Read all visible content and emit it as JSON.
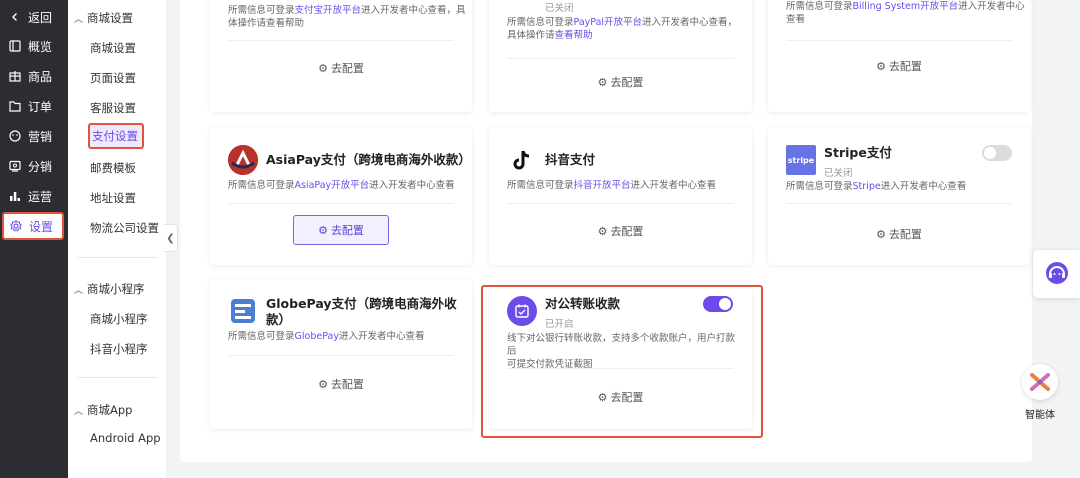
{
  "leftnav": {
    "back": "返回",
    "items": [
      {
        "label": "概览",
        "icon": "overview-icon"
      },
      {
        "label": "商品",
        "icon": "product-icon"
      },
      {
        "label": "订单",
        "icon": "order-icon"
      },
      {
        "label": "营销",
        "icon": "marketing-icon"
      },
      {
        "label": "分销",
        "icon": "distribution-icon"
      },
      {
        "label": "运营",
        "icon": "operation-icon"
      },
      {
        "label": "设置",
        "icon": "settings-icon"
      }
    ]
  },
  "subnav": {
    "group1": {
      "title": "商城设置",
      "items": [
        "商城设置",
        "页面设置",
        "客服设置",
        "支付设置",
        "邮费模板",
        "地址设置",
        "物流公司设置"
      ]
    },
    "group2": {
      "title": "商城小程序",
      "items": [
        "商城小程序",
        "抖音小程序"
      ]
    },
    "group3": {
      "title": "商城App",
      "items": [
        "Android App"
      ]
    }
  },
  "cards": {
    "alipay": {
      "desc_prefix": "所需信息可登录",
      "desc_link": "支付宝开放平台",
      "desc_suffix": "进入开发者中心查看，具体操作请查看帮助",
      "config": "去配置"
    },
    "paypal": {
      "status": "已关闭",
      "desc_prefix": "所需信息可登录",
      "desc_link": "PayPal开放平台",
      "desc_suffix": "进入开发者中心查看，",
      "desc_line2_prefix": "具体操作请",
      "desc_line2_link": "查看帮助",
      "config": "去配置"
    },
    "billing": {
      "desc_prefix": "所需信息可登录",
      "desc_link": "Billing System开放平台",
      "desc_suffix": "进入开发者中心",
      "desc_line2": "查看",
      "config": "去配置"
    },
    "asiapay": {
      "title": "AsiaPay支付（跨境电商海外收款）",
      "desc_prefix": "所需信息可登录",
      "desc_link": "AsiaPay开放平台",
      "desc_suffix": "进入开发者中心查看",
      "config": "去配置"
    },
    "douyin": {
      "title": "抖音支付",
      "desc_prefix": "所需信息可登录",
      "desc_link": "抖音开放平台",
      "desc_suffix": "进入开发者中心查看",
      "config": "去配置"
    },
    "stripe": {
      "title": "Stripe支付",
      "logo_text": "stripe",
      "status": "已关闭",
      "desc_prefix": "所需信息可登录",
      "desc_link": "Stripe",
      "desc_suffix": "进入开发者中心查看",
      "config": "去配置",
      "enabled": false
    },
    "globepay": {
      "title_line1": "GlobePay支付（跨境电商海外收",
      "title_line2": "款）",
      "desc_prefix": "所需信息可登录",
      "desc_link": "GlobePay",
      "desc_suffix": "进入开发者中心查看",
      "config": "去配置"
    },
    "transfer": {
      "title": "对公转账收款",
      "status": "已开启",
      "desc_line1": "线下对公银行转账收款，支持多个收款账户，用户打款后",
      "desc_line2": "可提交付款凭证截图",
      "config": "去配置",
      "enabled": true
    }
  },
  "widgets": {
    "ai_label": "智能体"
  },
  "colors": {
    "accent": "#6b4ce8",
    "highlight": "#e0533d",
    "nav_bg": "#2b2d33"
  }
}
